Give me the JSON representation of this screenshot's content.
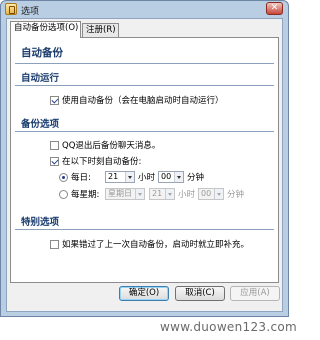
{
  "window": {
    "title": "选项",
    "close_glyph": "✕"
  },
  "tabs": [
    {
      "label": "自动备份选项(O)",
      "active": true
    },
    {
      "label": "注册(R)",
      "active": false
    }
  ],
  "page_title": "自动备份",
  "sections": {
    "autorun": {
      "heading": "自动运行",
      "option": {
        "label": "使用自动备份（会在电脑启动时自动运行）",
        "checked": true
      }
    },
    "backup": {
      "heading": "备份选项",
      "qq_exit": {
        "label": "QQ退出后备份聊天消息。",
        "checked": false
      },
      "scheduled": {
        "label": "在以下时刻自动备份:",
        "checked": true
      },
      "daily": {
        "label": "每日:",
        "selected": true,
        "hour": "21",
        "hour_unit": "小时",
        "minute": "00",
        "minute_unit": "分钟"
      },
      "weekly": {
        "label": "每星期:",
        "selected": false,
        "day": "星期日",
        "hour": "21",
        "hour_unit": "小时",
        "minute": "00",
        "minute_unit": "分钟"
      }
    },
    "special": {
      "heading": "特别选项",
      "catch_up": {
        "label": "如果错过了上一次自动备份，启动时就立即补充。",
        "checked": false
      }
    }
  },
  "buttons": {
    "ok": "确定(O)",
    "cancel": "取消(C)",
    "apply": "应用(A)"
  },
  "watermark": "www.duowen123.com",
  "colors": {
    "title_bar": "#b9cde3",
    "heading": "#1a3c6e",
    "accent": "#3c7fb1"
  }
}
